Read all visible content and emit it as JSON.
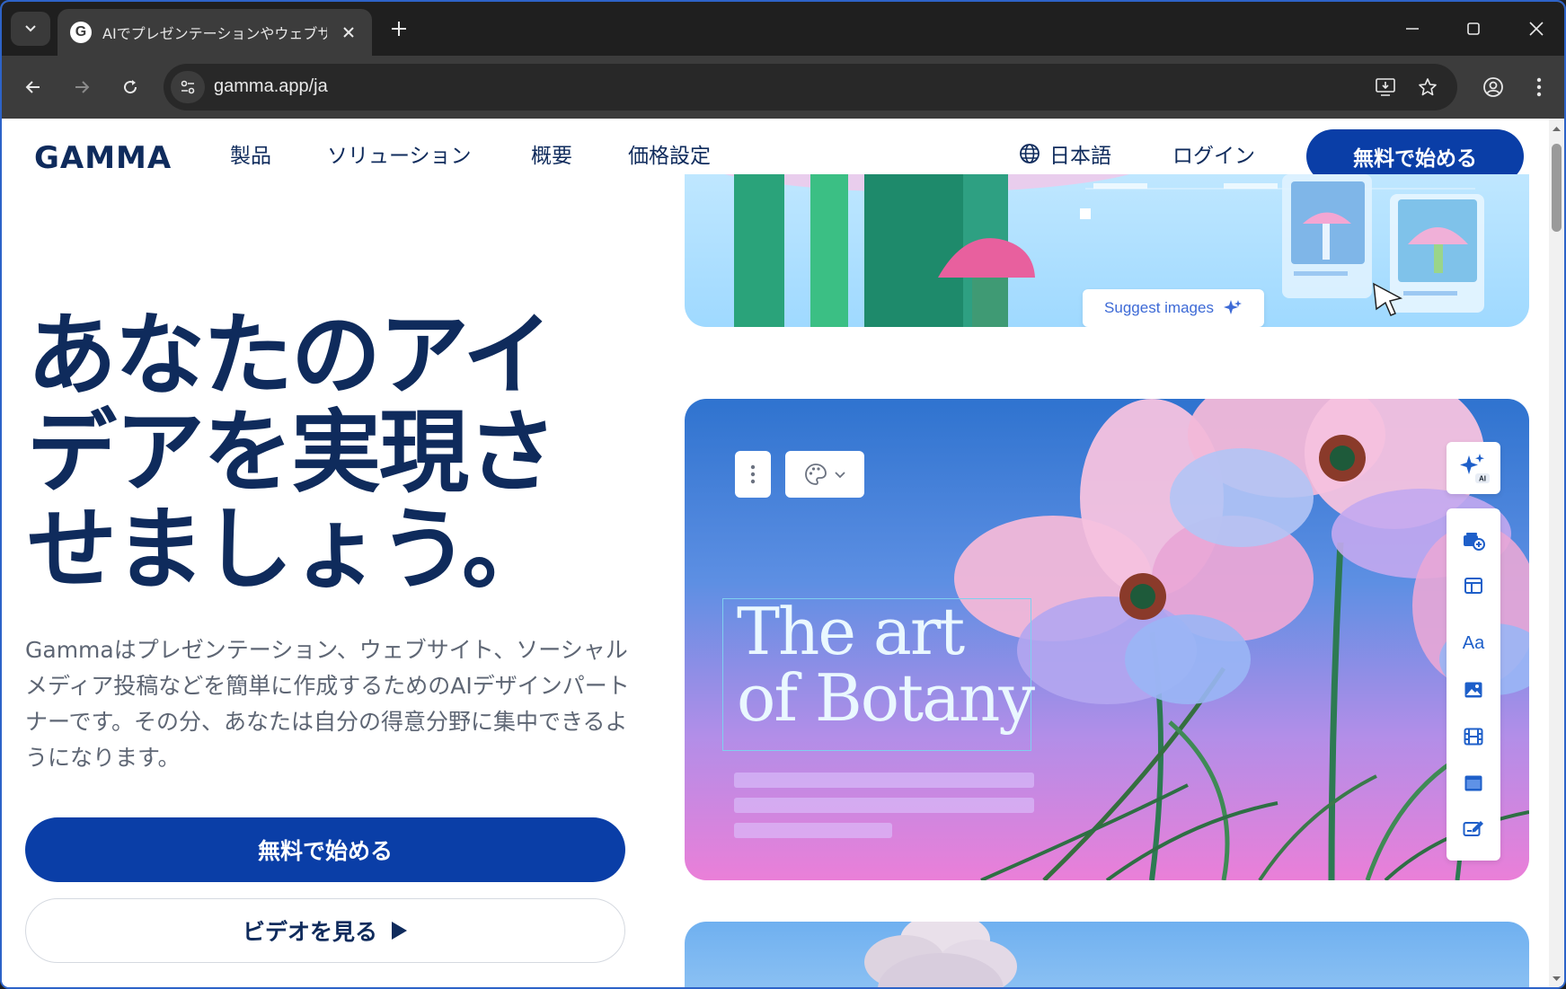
{
  "browser": {
    "tab_title": "AIでプレゼンテーションやウェブサイトを",
    "favicon_letter": "G",
    "url": "gamma.app/ja"
  },
  "nav": {
    "logo": "GAMMA",
    "links": [
      "製品",
      "ソリューション",
      "概要",
      "価格設定"
    ],
    "language": "日本語",
    "login": "ログイン",
    "cta": "無料で始める"
  },
  "hero": {
    "title_lines": [
      "あなたのアイ",
      "デアを実現さ",
      "せましょう。"
    ],
    "subtitle": "Gammaはプレゼンテーション、ウェブサイト、ソーシャルメディア投稿などを簡単に作成するためのAIデザインパートナーです。その分、あなたは自分の得意分野に集中できるようになります。",
    "cta_primary": "無料で始める",
    "cta_video": "ビデオを見る"
  },
  "cards": {
    "suggest_images": "Suggest images",
    "art_title_lines": [
      "The art",
      "of Botany"
    ],
    "ai_badge": "AI",
    "font_tool": "Aa"
  },
  "colors": {
    "brand_blue": "#0a3ea7",
    "ink": "#0f2b5c",
    "muted": "#5e6674"
  }
}
